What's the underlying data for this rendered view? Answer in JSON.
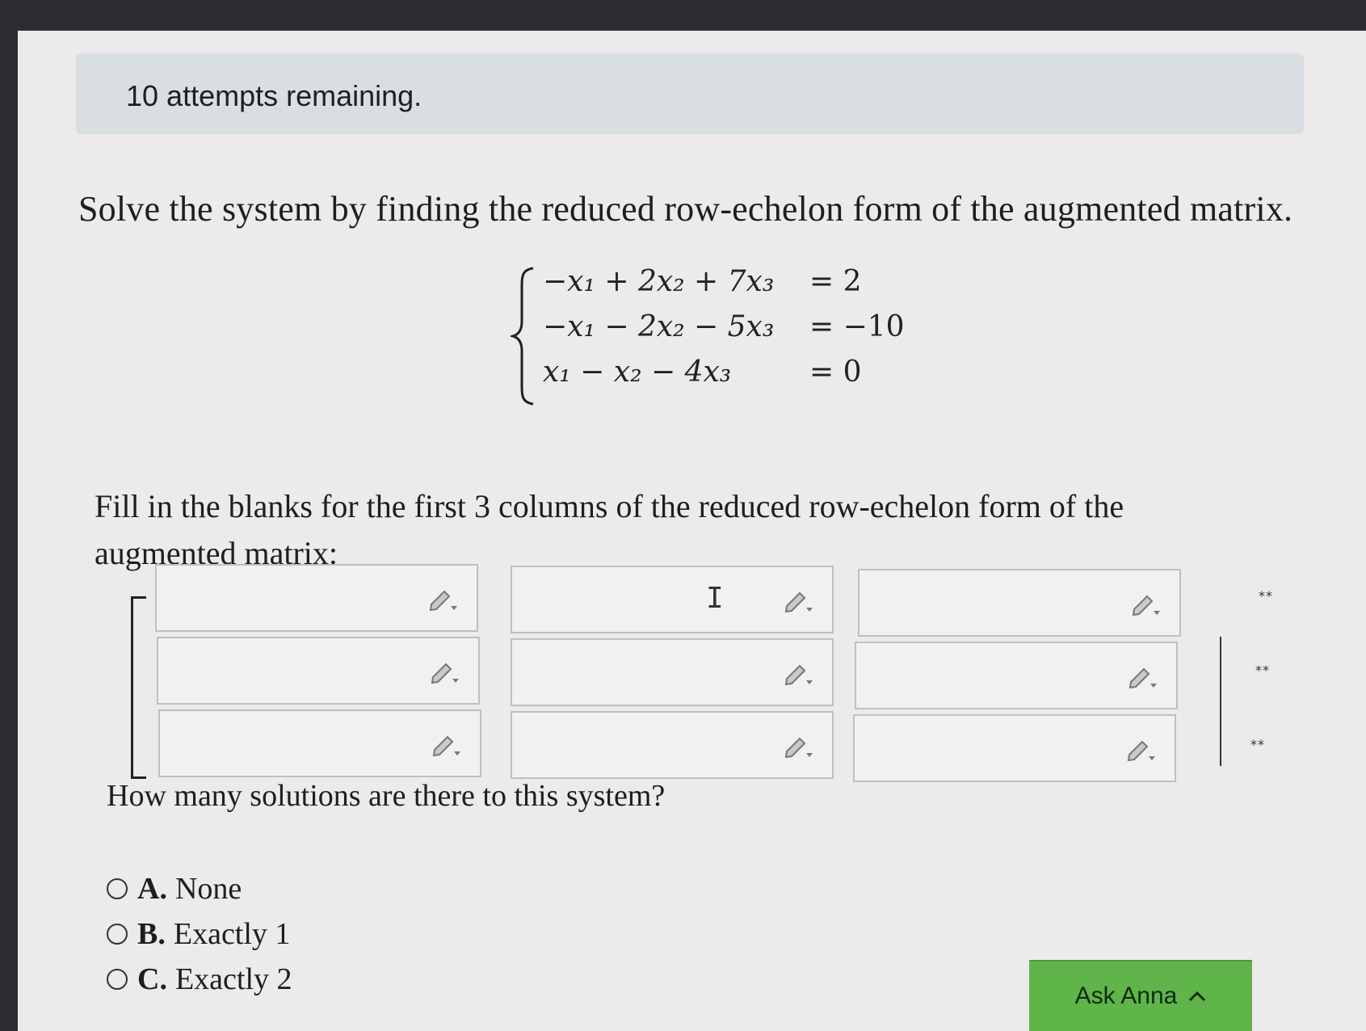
{
  "header": {
    "attempts_text": "10 attempts remaining."
  },
  "question": {
    "prompt": "Solve the system by finding the reduced row-echelon form of the augmented matrix.",
    "equations": [
      {
        "lhs": "−x₁ + 2x₂ + 7x₃",
        "rhs": "= 2"
      },
      {
        "lhs": "−x₁ − 2x₂ − 5x₃",
        "rhs": "= −10"
      },
      {
        "lhs": "x₁ − x₂ − 4x₃",
        "rhs": "= 0"
      }
    ],
    "fill_instructions": "Fill in the blanks for the first 3 columns of the reduced row-echelon form of the augmented matrix:"
  },
  "matrix": {
    "cells": [
      {
        "value": ""
      },
      {
        "value": ""
      },
      {
        "value": ""
      },
      {
        "value": ""
      },
      {
        "value": ""
      },
      {
        "value": ""
      },
      {
        "value": ""
      },
      {
        "value": ""
      },
      {
        "value": ""
      }
    ],
    "augmented_column": [
      "**",
      "**",
      "**"
    ]
  },
  "solutions": {
    "question": "How many solutions are there to this system?",
    "options": [
      {
        "letter": "A.",
        "label": "None"
      },
      {
        "letter": "B.",
        "label": "Exactly 1"
      },
      {
        "letter": "C.",
        "label": "Exactly 2"
      }
    ]
  },
  "assistant": {
    "button_label": "Ask Anna",
    "icon": "chevron-up-icon",
    "color": "#5fb54a"
  },
  "icons": {
    "cell_editor": "pencil-icon",
    "cursor": "text-cursor-icon"
  }
}
